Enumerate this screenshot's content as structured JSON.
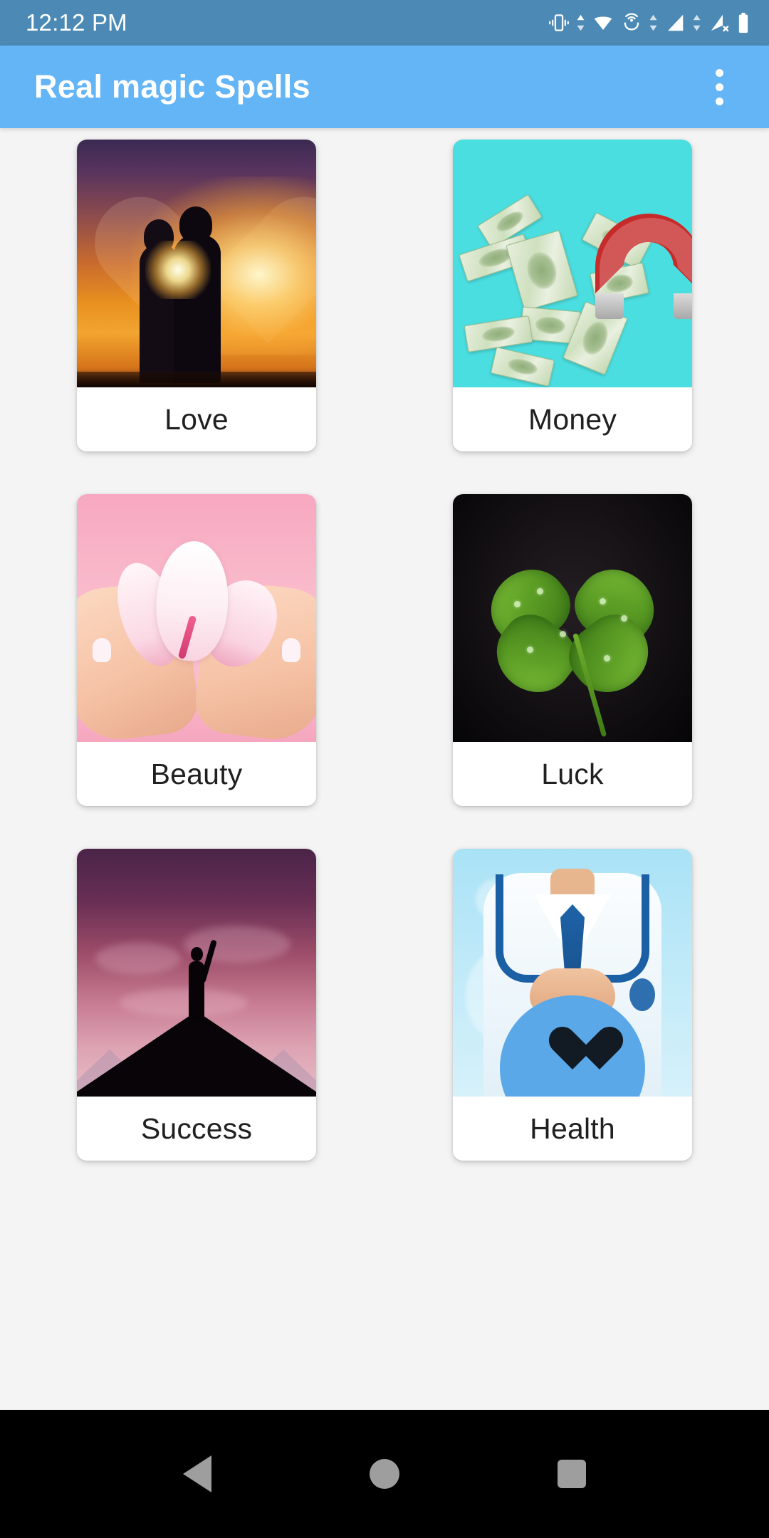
{
  "status_bar": {
    "time": "12:12 PM",
    "background_color": "#4C89B5",
    "icons": [
      {
        "name": "vibrate-icon",
        "label": "vibrate"
      },
      {
        "name": "data-transfer-icon",
        "label": "data transfer"
      },
      {
        "name": "wifi-icon",
        "label": "wifi"
      },
      {
        "name": "hotspot-icon",
        "label": "hotspot"
      },
      {
        "name": "data-transfer-icon-2",
        "label": "data transfer"
      },
      {
        "name": "signal-bars-icon",
        "label": "cellular signal"
      },
      {
        "name": "data-transfer-icon-3",
        "label": "data transfer"
      },
      {
        "name": "signal-off-icon",
        "label": "no signal"
      },
      {
        "name": "battery-icon",
        "label": "battery"
      }
    ]
  },
  "app_bar": {
    "title": "Real magic Spells",
    "background_color": "#64B5F6",
    "title_color": "#FFFFFF",
    "overflow_menu_label": "More options"
  },
  "content": {
    "background_color": "#F4F4F4",
    "cards": [
      {
        "label": "Love",
        "art": "love",
        "image_alt": "Couple silhouette kissing at sunset with heart bokeh"
      },
      {
        "label": "Money",
        "art": "money",
        "image_alt": "Dollar bills flying toward a red horseshoe magnet on turquoise"
      },
      {
        "label": "Beauty",
        "art": "beauty",
        "image_alt": "Hands holding a white orchid flower on pink background"
      },
      {
        "label": "Luck",
        "art": "luck",
        "image_alt": "Four leaf clover with dew drops on black background"
      },
      {
        "label": "Success",
        "art": "success",
        "image_alt": "Person raising arm on mountain peak against purple sky"
      },
      {
        "label": "Health",
        "art": "health",
        "image_alt": "Doctor with stethoscope holding blue heart icon"
      }
    ]
  },
  "nav_bar": {
    "background_color": "#000000",
    "buttons": [
      {
        "name": "nav-back-button",
        "label": "Back"
      },
      {
        "name": "nav-home-button",
        "label": "Home"
      },
      {
        "name": "nav-recents-button",
        "label": "Recent apps"
      }
    ]
  }
}
